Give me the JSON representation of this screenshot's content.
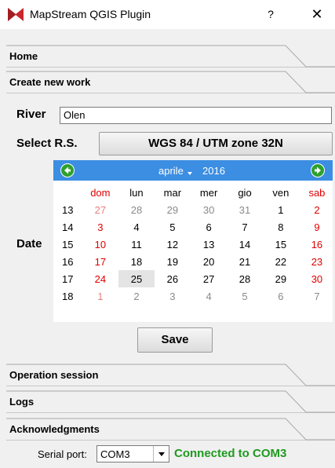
{
  "window": {
    "title": "MapStream QGIS Plugin",
    "help_label": "?",
    "close_label": "✕"
  },
  "tabs": {
    "home": "Home",
    "create": "Create new work",
    "operation": "Operation session",
    "logs": "Logs",
    "ack": "Acknowledgments"
  },
  "form": {
    "river_label": "River",
    "river_value": "Olen",
    "rs_label": "Select R.S.",
    "rs_value": "WGS 84 / UTM zone 32N",
    "date_label": "Date",
    "save_label": "Save"
  },
  "calendar": {
    "month": "aprile",
    "year": "2016",
    "days": [
      "dom",
      "lun",
      "mar",
      "mer",
      "gio",
      "ven",
      "sab"
    ],
    "weeks": [
      {
        "wk": "13",
        "d": [
          "27",
          "28",
          "29",
          "30",
          "31",
          "1",
          "2"
        ]
      },
      {
        "wk": "14",
        "d": [
          "3",
          "4",
          "5",
          "6",
          "7",
          "8",
          "9"
        ]
      },
      {
        "wk": "15",
        "d": [
          "10",
          "11",
          "12",
          "13",
          "14",
          "15",
          "16"
        ]
      },
      {
        "wk": "16",
        "d": [
          "17",
          "18",
          "19",
          "20",
          "21",
          "22",
          "23"
        ]
      },
      {
        "wk": "17",
        "d": [
          "24",
          "25",
          "26",
          "27",
          "28",
          "29",
          "30"
        ]
      },
      {
        "wk": "18",
        "d": [
          "1",
          "2",
          "3",
          "4",
          "5",
          "6",
          "7"
        ]
      }
    ],
    "selected": "25"
  },
  "serial": {
    "label": "Serial port:",
    "value": "COM3",
    "status": "Connected to COM3",
    "status_color": "#1e9a1e"
  },
  "colors": {
    "calendar_header": "#3b8ee2",
    "weekend": "#e00000",
    "app_icon": "#c8282d"
  }
}
